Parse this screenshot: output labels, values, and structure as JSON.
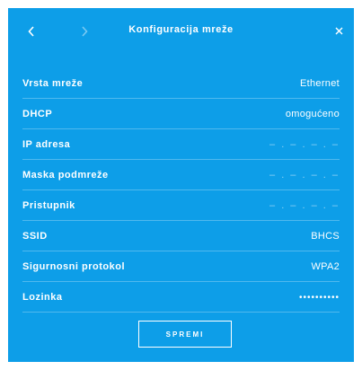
{
  "header": {
    "title": "Konfiguracija mreže",
    "prev_icon": "chevron-left-icon",
    "next_icon": "chevron-right-icon",
    "close_icon": "close-icon"
  },
  "colors": {
    "panel_background": "#0d9ee8",
    "text": "#ffffff"
  },
  "rows": [
    {
      "label": "Vrsta mreže",
      "value": "Ethernet"
    },
    {
      "label": "DHCP",
      "value": "omogućeno"
    },
    {
      "label": "IP adresa",
      "value": "– . – . – . –"
    },
    {
      "label": "Maska podmreže",
      "value": "– . – . – . –"
    },
    {
      "label": "Pristupnik",
      "value": "– . – . – . –"
    },
    {
      "label": "SSID",
      "value": "BHCS"
    },
    {
      "label": "Sigurnosni protokol",
      "value": "WPA2"
    },
    {
      "label": "Lozinka",
      "value": "••••••••••"
    }
  ],
  "footer": {
    "save_label": "SPREMI"
  }
}
